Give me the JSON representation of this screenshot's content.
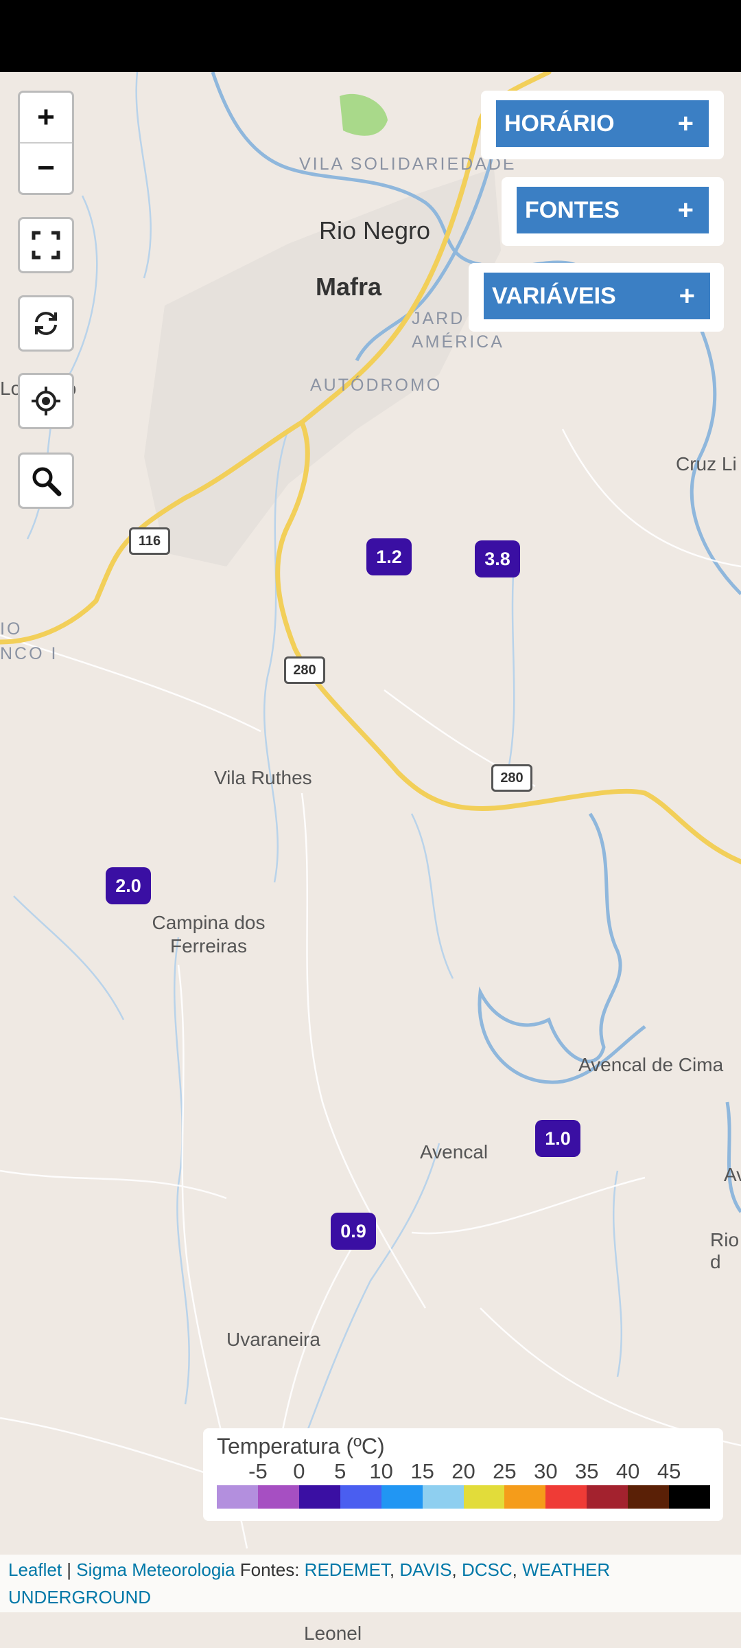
{
  "map": {
    "zoom_in": "+",
    "zoom_out": "−",
    "places": {
      "vila_solidariedade": "VILA SOLIDARIEDADE",
      "rio_negro": "Rio Negro",
      "mafra": "Mafra",
      "jardim_america": "JARD AMÉRICA",
      "autodromo": "AUTÓDROMO",
      "lo": "Lo",
      "to": "to",
      "cruz": "Cruz Li",
      "io": "IO",
      "nco": "NCO I",
      "vila_ruthes": "Vila Ruthes",
      "campina": "Campina dos Ferreiras",
      "avencal_cima": "Avencal de Cima",
      "avencal": "Avencal",
      "uvaraneira": "Uvaraneira",
      "leonel": "Leonel",
      "av": "Av",
      "rio_d": "Rio d"
    },
    "shields": [
      "116",
      "280",
      "280"
    ],
    "markers": [
      "1.2",
      "3.8",
      "2.0",
      "1.0",
      "0.9"
    ]
  },
  "controls": {
    "horario": "HORÁRIO",
    "fontes": "FONTES",
    "variaveis": "VARIÁVEIS",
    "plus": "+"
  },
  "legend": {
    "title": "Temperatura (ºC)",
    "ticks": [
      "-5",
      "0",
      "5",
      "10",
      "15",
      "20",
      "25",
      "30",
      "35",
      "40",
      "45"
    ],
    "colors": [
      "#b38fde",
      "#a64fc2",
      "#3a0fa3",
      "#4a5ef0",
      "#2196f3",
      "#8ecff0",
      "#e2dc3a",
      "#f59c1a",
      "#ef3b36",
      "#a3222e",
      "#5a2006",
      "#000000"
    ]
  },
  "attribution": {
    "leaflet": "Leaflet",
    "sep": " | ",
    "sigma": "Sigma Meteorologia",
    "fontes_label": " Fontes: ",
    "redemet": "REDEMET",
    "davis": "DAVIS",
    "dcsc": "DCSC",
    "wu": "WEATHER UNDERGROUND",
    "comma": ", "
  },
  "colors": {
    "marker": "#3a0fa3",
    "button": "#3b7fc4"
  }
}
